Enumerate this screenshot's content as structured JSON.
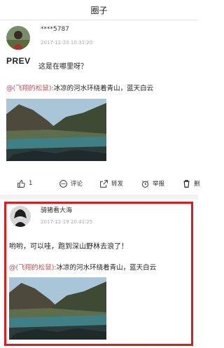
{
  "header": {
    "title": "圈子"
  },
  "overlay": {
    "prev_label": "PREV"
  },
  "posts": [
    {
      "username": "****5787",
      "time": "2017-12-20 10:31:20",
      "content": "这是在哪里呀？",
      "quote": {
        "mention": "@(飞翔的松鼠):",
        "text": "冰凉的河水环绕着青山，蓝天白云"
      }
    },
    {
      "username": "骑猪看大海",
      "time": "2017-12-19 20:41:25",
      "content": "哟哟，可以哇，跑到深山野林去浪了！",
      "quote": {
        "mention": "@(飞翔的松鼠):",
        "text": "冰凉的河水环绕着青山，蓝天白云"
      }
    }
  ],
  "actions": [
    {
      "icon": "thumbs-up-icon",
      "label": "1"
    },
    {
      "icon": "comment-icon",
      "label": "评论"
    },
    {
      "icon": "share-icon",
      "label": "转发"
    },
    {
      "icon": "alarm-icon",
      "label": "举报"
    },
    {
      "icon": "trash-icon",
      "label": "删"
    }
  ],
  "colors": {
    "mention": "#c0505a",
    "highlight": "#e21a1a"
  }
}
